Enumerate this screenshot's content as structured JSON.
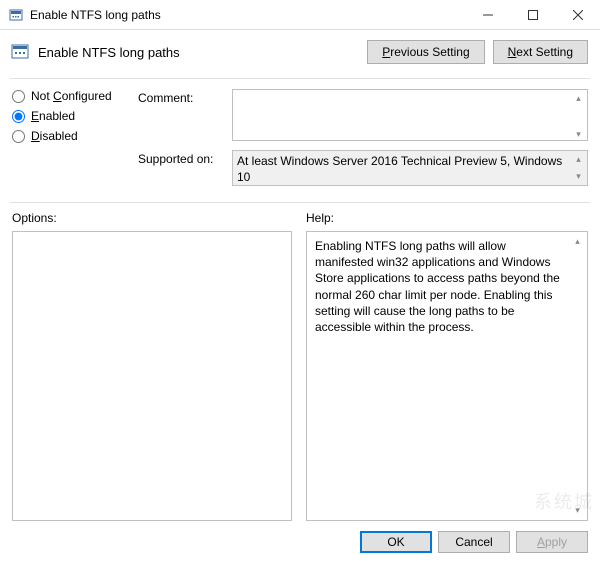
{
  "window": {
    "title": "Enable NTFS long paths"
  },
  "header": {
    "title": "Enable NTFS long paths",
    "prev_label_pre": "P",
    "prev_label_post": "revious Setting",
    "next_label_pre": "N",
    "next_label_post": "ext Setting"
  },
  "state": {
    "not_configured": {
      "label": "Not Configured",
      "key": "C",
      "selected": false
    },
    "enabled": {
      "label": "Enabled",
      "key": "E",
      "selected": true
    },
    "disabled": {
      "label": "Disabled",
      "key": "D",
      "selected": false
    }
  },
  "fields": {
    "comment_label": "Comment:",
    "comment_value": "",
    "supported_label": "Supported on:",
    "supported_value": "At least Windows Server 2016 Technical Preview 5, Windows 10"
  },
  "panels": {
    "options_label": "Options:",
    "options_text": "",
    "help_label": "Help:",
    "help_text": "Enabling NTFS long paths will allow manifested win32 applications and Windows Store applications to access paths beyond the normal 260 char limit per node.  Enabling this setting will cause the long paths to be accessible within the process."
  },
  "footer": {
    "ok": "OK",
    "cancel": "Cancel",
    "apply": "Apply"
  },
  "watermark": "系统城"
}
